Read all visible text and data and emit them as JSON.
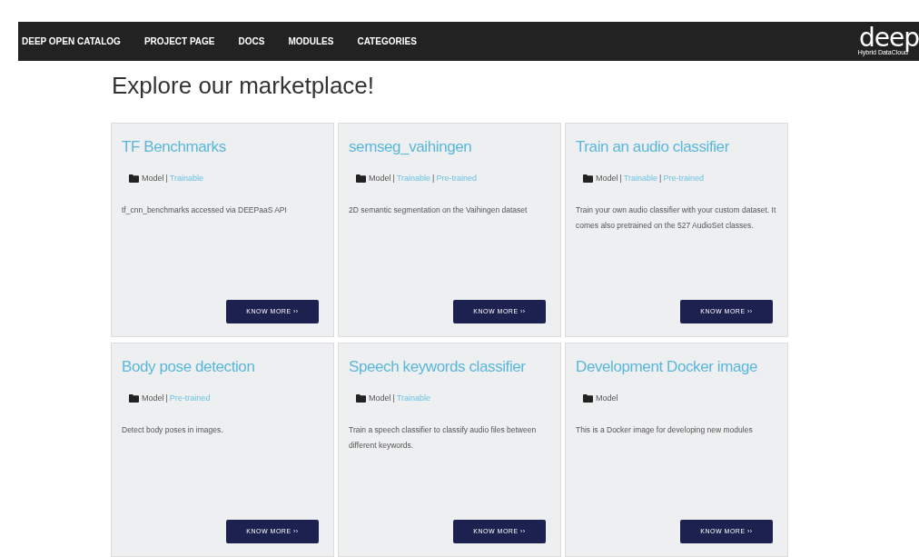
{
  "nav": {
    "items": [
      "DEEP OPEN CATALOG",
      "PROJECT PAGE",
      "DOCS",
      "MODULES",
      "CATEGORIES"
    ],
    "logo": {
      "mark": "deep",
      "subtitle": "Hybrid DataCloud"
    }
  },
  "heading": "Explore our marketplace!",
  "cards": [
    {
      "title": "TF Benchmarks",
      "category": "Model",
      "tags": [
        {
          "sep": "|",
          "label": "Trainable"
        }
      ],
      "description": "tf_cnn_benchmarks accessed via DEEPaaS API",
      "button": "KNOW MORE ››"
    },
    {
      "title": "semseg_vaihingen",
      "category": "Model",
      "tags": [
        {
          "sep": "|",
          "label": "Trainable"
        },
        {
          "sep": "|",
          "label": "Pre-trained"
        }
      ],
      "description": "2D semantic segmentation on the Vaihingen dataset",
      "button": "KNOW MORE ››"
    },
    {
      "title": "Train an audio classifier",
      "category": "Model",
      "tags": [
        {
          "sep": "|",
          "label": "Trainable"
        },
        {
          "sep": "|",
          "label": "Pre-trained"
        }
      ],
      "description": "Train your own audio classifier with your custom dataset. It comes also pretrained on the 527 AudioSet classes.",
      "button": "KNOW MORE ››"
    },
    {
      "title": "Body pose detection",
      "category": "Model",
      "tags": [
        {
          "sep": "|",
          "label": "Pre-trained"
        }
      ],
      "description": "Detect body poses in images.",
      "button": "KNOW MORE ››"
    },
    {
      "title": "Speech keywords classifier",
      "category": "Model",
      "tags": [
        {
          "sep": "|",
          "label": "Trainable"
        }
      ],
      "description": "Train a speech classifier to classify audio files between different keywords.",
      "button": "KNOW MORE ››"
    },
    {
      "title": "Development Docker image",
      "category": "Model",
      "description": "This is a Docker image for developing new modules",
      "button": "KNOW MORE ››"
    }
  ]
}
